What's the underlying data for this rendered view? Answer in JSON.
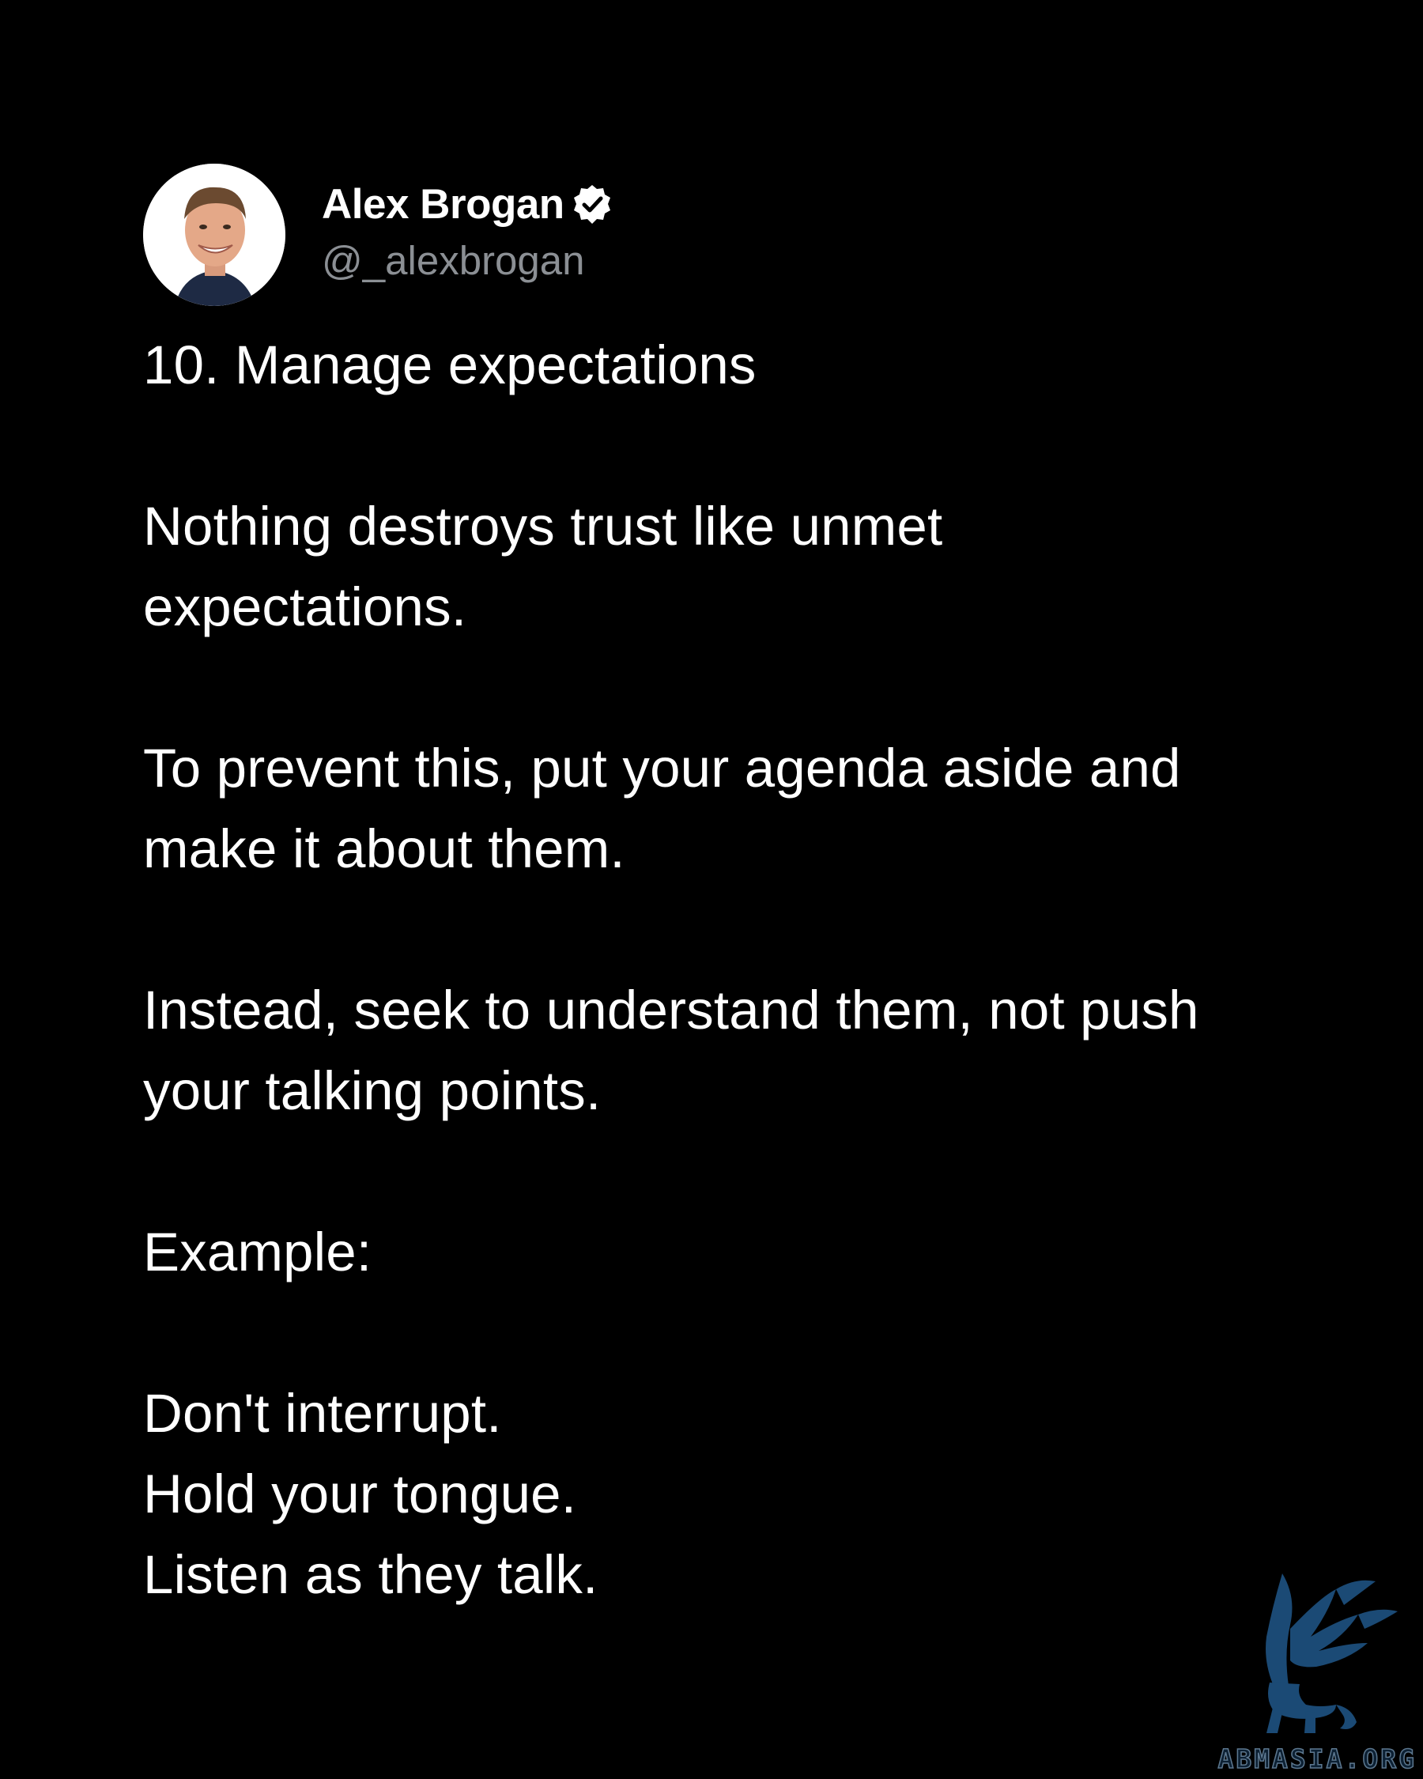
{
  "author": {
    "name": "Alex Brogan",
    "handle": "@_alexbrogan",
    "avatar_icon": "profile-photo",
    "verified_icon": "verified-badge-icon"
  },
  "post": {
    "paragraphs": [
      [
        "10. Manage expectations"
      ],
      [
        "Nothing destroys trust like unmet",
        "expectations."
      ],
      [
        "To prevent this, put your agenda aside and",
        "make it about them."
      ],
      [
        "Instead, seek to understand them, not push",
        "your talking points."
      ],
      [
        "Example:"
      ],
      [
        "Don't interrupt.",
        "Hold your tongue.",
        "Listen as they talk."
      ]
    ]
  },
  "watermark": {
    "text": "ABMASIA.ORG",
    "logo_icon": "winged-lion-logo",
    "color": "#1b4a75"
  },
  "colors": {
    "background": "#000000",
    "text": "#ffffff",
    "handle": "#8b8f94"
  }
}
